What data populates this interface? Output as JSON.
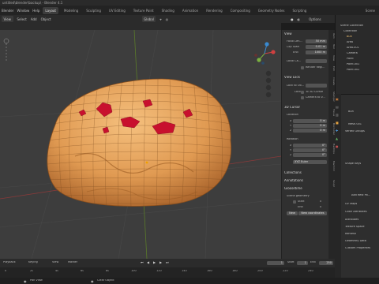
{
  "title": "untitled\\blender\\backup\\ - Blender 4.1",
  "menu": [
    "Blender",
    "Window",
    "Help"
  ],
  "workspaces": [
    "Layout",
    "Modeling",
    "Sculpting",
    "UV Editing",
    "Texture Paint",
    "Shading",
    "Animation",
    "Rendering",
    "Compositing",
    "Geometry Nodes",
    "Scripting"
  ],
  "active_workspace": "Layout",
  "scene_label": "Scene",
  "toolbar": {
    "mode": "View",
    "select": "Select",
    "add": "Add",
    "object": "Object",
    "global": "Global",
    "options": "Options"
  },
  "npanel": {
    "view_header": "View",
    "focal_label": "Focal Len...",
    "focal_value": "50 mm",
    "clip_start_label": "Clip Start",
    "clip_start_value": "0.01 m",
    "clip_end_label": "End",
    "clip_end_value": "1000 m",
    "local_cam_label": "Local Ca...",
    "render_region_label": "Render Regi...",
    "view_lock_header": "View Lock",
    "lock_obj_label": "Lock to Ob...",
    "lock_label": "Lock",
    "to_3d_cursor": "To 3D Cursor",
    "camera_to_view": "Camera to V...",
    "cursor_header": "3D Cursor",
    "location_label": "Location",
    "loc_x": "0 m",
    "loc_y": "0 m",
    "loc_z": "0 m",
    "rotation_label": "Rotation",
    "rot_x": "0°",
    "rot_y": "0°",
    "rot_z": "0°",
    "xyz_euler": "XYZ Euler",
    "collections_header": "Collections",
    "annotations_header": "Annotations",
    "gloosetime_header": "Gloosetime",
    "scene_geometry": "Scene geometry",
    "start_label": "Start",
    "start_value": "0",
    "end_label": "End",
    "end_value": "0",
    "new_btn": "New",
    "new_coordinates": "New coordinates"
  },
  "ntabs": [
    "Item",
    "Tool",
    "View",
    "Edit",
    "Create",
    "Stamper",
    "Tissue",
    "BoxCutter",
    "HardOps",
    "Machin3",
    "Sculpt"
  ],
  "outliner": {
    "header": "Scene Collection",
    "items": [
      "Collection",
      "Bun",
      "Area",
      "Area.001",
      "Camera",
      "Point",
      "Point.001",
      "Point.002"
    ]
  },
  "props": {
    "object": "Bun",
    "mesh": "Mesh.001",
    "vertex_groups": "Vertex Groups",
    "shape_keys": "Shape Keys",
    "add_rest": "Add Rest Po...",
    "uv_maps": "UV Maps",
    "color_attributes": "Color Attributes",
    "attributes": "Attributes",
    "texture_space": "Texture Space",
    "remesh": "Remesh",
    "geometry_data": "Geometry Data",
    "custom_props": "Custom Properties"
  },
  "timeline": {
    "playback": "Playback",
    "keying": "Keying",
    "view": "View",
    "marker": "Marker",
    "current": "1",
    "start_label": "Start",
    "start": "1",
    "end_label": "End",
    "end": "250"
  },
  "frame_numbers": [
    "0",
    "20",
    "40",
    "60",
    "80",
    "100",
    "120",
    "140",
    "160",
    "180",
    "200",
    "220",
    "240"
  ],
  "status": {
    "left": "Pan View",
    "right": "Clear Object"
  },
  "colors": {
    "bun": "#e8a35a",
    "bun_dark": "#b86f2c",
    "jam": "#c8102e",
    "wire": "#7a4a20",
    "grid": "#4a4a4a",
    "accent": "#4772b3"
  }
}
